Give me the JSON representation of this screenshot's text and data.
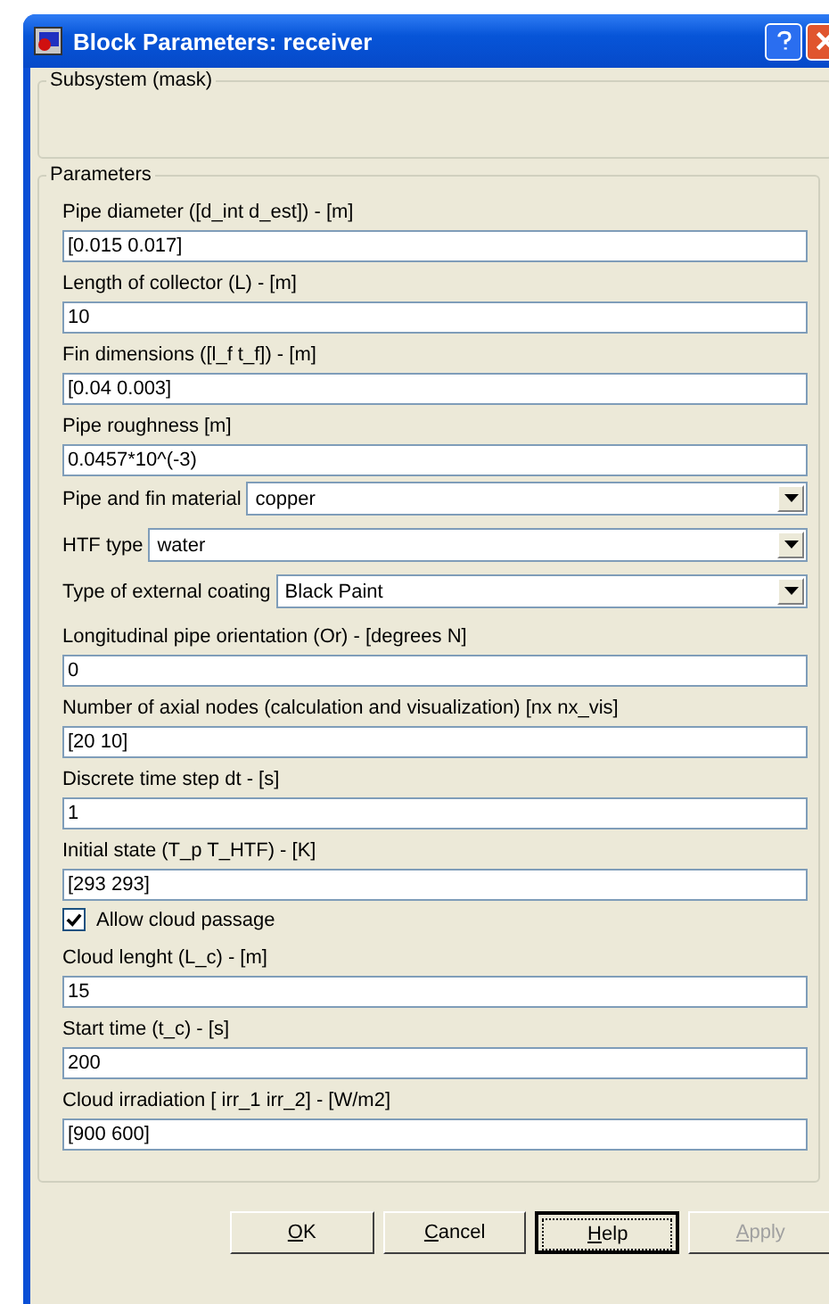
{
  "window": {
    "title": "Block Parameters: receiver"
  },
  "mask": {
    "title": "Subsystem (mask)"
  },
  "parameters": {
    "title": "Parameters",
    "items": [
      {
        "kind": "text",
        "label": "Pipe diameter ([d_int  d_est]) - [m]",
        "value": "[0.015 0.017]"
      },
      {
        "kind": "text",
        "label": "Length of collector (L) - [m]",
        "value": "10"
      },
      {
        "kind": "text",
        "label": "Fin dimensions ([l_f   t_f]) - [m]",
        "value": "[0.04 0.003]"
      },
      {
        "kind": "text",
        "label": "Pipe roughness [m]",
        "value": "0.0457*10^(-3)"
      },
      {
        "kind": "select",
        "label": "Pipe and fin material",
        "value": "copper"
      },
      {
        "kind": "select",
        "label": "HTF type",
        "value": "water"
      },
      {
        "kind": "select",
        "label": "Type of external coating",
        "value": "Black Paint"
      },
      {
        "kind": "text",
        "label": "Longitudinal pipe orientation  (Or) - [degrees N]",
        "value": "0"
      },
      {
        "kind": "text",
        "label": "Number of axial nodes (calculation and visualization) [nx   nx_vis]",
        "value": "[20 10]"
      },
      {
        "kind": "text",
        "label": "Discrete time step dt - [s]",
        "value": "1"
      },
      {
        "kind": "text",
        "label": "Initial state  (T_p   T_HTF) - [K]",
        "value": "[293 293]"
      },
      {
        "kind": "checkbox",
        "label": "Allow cloud passage",
        "checked": true
      },
      {
        "kind": "text",
        "label": "Cloud lenght (L_c) - [m]",
        "value": "15"
      },
      {
        "kind": "text",
        "label": "Start time (t_c) - [s]",
        "value": "200"
      },
      {
        "kind": "text",
        "label": "Cloud irradiation [ irr_1  irr_2] - [W/m2]",
        "value": "[900 600]"
      }
    ]
  },
  "buttons": [
    {
      "label": "OK",
      "focused": false,
      "disabled": false
    },
    {
      "label": "Cancel",
      "focused": false,
      "disabled": false
    },
    {
      "label": "Help",
      "focused": true,
      "disabled": false
    },
    {
      "label": "Apply",
      "focused": false,
      "disabled": true
    }
  ]
}
